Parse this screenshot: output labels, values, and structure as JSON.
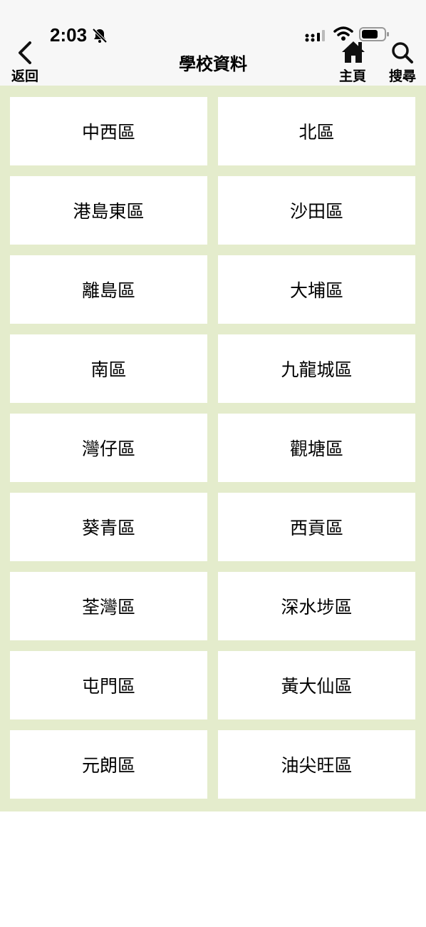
{
  "status_bar": {
    "time": "2:03"
  },
  "header": {
    "back_label": "返回",
    "title": "學校資料",
    "home_label": "主頁",
    "search_label": "搜尋"
  },
  "colors": {
    "content_background": "#e4eccc",
    "cell_background": "#ffffff",
    "header_background": "#f7f7f7"
  },
  "icons": {
    "back": "chevron-left-icon",
    "home": "home-icon",
    "search": "search-icon",
    "mute": "bell-slash-icon",
    "signal": "cellular-signal-icon",
    "wifi": "wifi-icon",
    "battery": "battery-icon"
  },
  "districts": [
    "中西區",
    "北區",
    "港島東區",
    "沙田區",
    "離島區",
    "大埔區",
    "南區",
    "九龍城區",
    "灣仔區",
    "觀塘區",
    "葵青區",
    "西貢區",
    "荃灣區",
    "深水埗區",
    "屯門區",
    "黃大仙區",
    "元朗區",
    "油尖旺區"
  ]
}
